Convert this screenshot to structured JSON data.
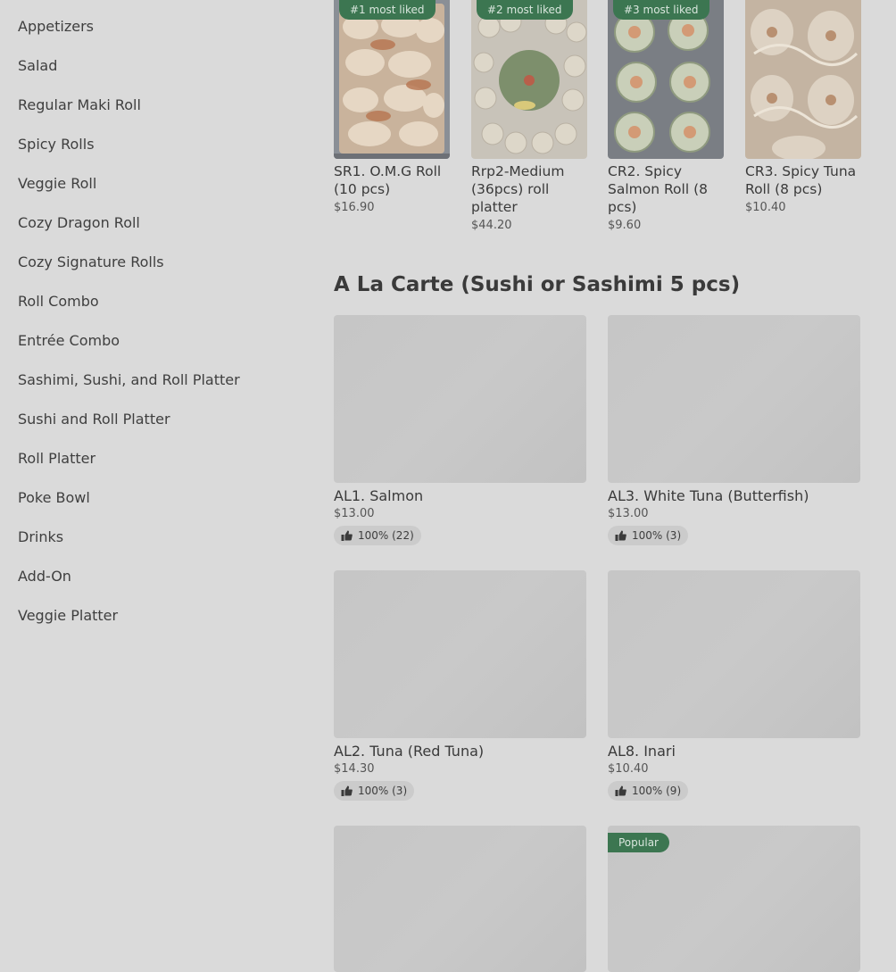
{
  "sidebar": {
    "items": [
      "Appetizers",
      "Salad",
      "Regular Maki Roll",
      "Spicy Rolls",
      "Veggie Roll",
      "Cozy Dragon Roll",
      "Cozy Signature Rolls",
      "Roll Combo",
      "Entrée Combo",
      "Sashimi, Sushi, and Roll Platter",
      "Sushi and Roll Platter",
      "Roll Platter",
      "Poke Bowl",
      "Drinks",
      "Add-On",
      "Veggie Platter"
    ]
  },
  "most_liked": [
    {
      "badge": "#1 most liked",
      "name": "SR1. O.M.G Roll (10 pcs)",
      "price": "$16.90"
    },
    {
      "badge": "#2 most liked",
      "name": "Rrp2-Medium (36pcs) roll platter",
      "price": "$44.20"
    },
    {
      "badge": "#3 most liked",
      "name": "CR2. Spicy Salmon Roll (8 pcs)",
      "price": "$9.60"
    },
    {
      "badge": "",
      "name": "CR3. Spicy Tuna Roll (8 pcs)",
      "price": "$10.40"
    }
  ],
  "section": {
    "title": "A La Carte (Sushi or Sashimi 5 pcs)"
  },
  "items": [
    {
      "name": "AL1. Salmon",
      "price": "$13.00",
      "rating": "100% (22)"
    },
    {
      "name": "AL3. White Tuna (Butterfish)",
      "price": "$13.00",
      "rating": "100% (3)"
    },
    {
      "name": "AL2. Tuna (Red Tuna)",
      "price": "$14.30",
      "rating": "100% (3)"
    },
    {
      "name": "AL8. Inari",
      "price": "$10.40",
      "rating": "100% (9)"
    }
  ],
  "popular_badge": "Popular",
  "colors": {
    "badge_green": "#3c7651",
    "overlay_gray": "#dadada"
  }
}
